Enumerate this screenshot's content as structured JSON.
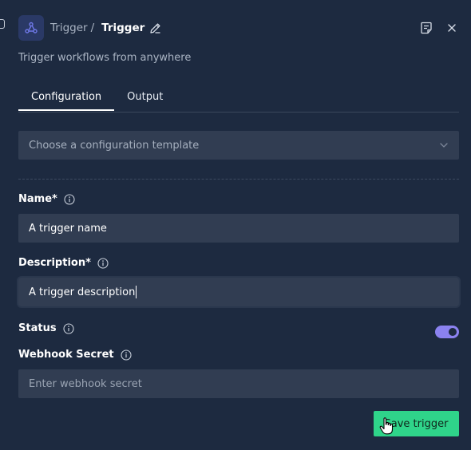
{
  "header": {
    "breadcrumb": "Trigger",
    "separator": "/",
    "title": "Trigger",
    "icons": {
      "app": "webhook-icon",
      "edit": "pencil-icon",
      "notes": "notes-icon",
      "close": "close-icon"
    }
  },
  "subtitle": "Trigger workflows from anywhere",
  "tabs": [
    {
      "label": "Configuration",
      "active": true
    },
    {
      "label": "Output",
      "active": false
    }
  ],
  "template_select": {
    "placeholder": "Choose a configuration template",
    "icon": "chevron-down-icon"
  },
  "fields": {
    "name": {
      "label": "Name*",
      "value": "A trigger name"
    },
    "description": {
      "label": "Description*",
      "value": "A trigger description"
    },
    "status": {
      "label": "Status",
      "enabled": true
    },
    "webhook_secret": {
      "label": "Webhook Secret",
      "placeholder": "Enter webhook secret"
    }
  },
  "actions": {
    "save_label": "Save trigger"
  },
  "colors": {
    "background": "#1d2a40",
    "input_bg": "#313d52",
    "accent_icon": "#2a3966",
    "toggle_on": "#8b82f0",
    "save_button": "#2fd48a"
  }
}
